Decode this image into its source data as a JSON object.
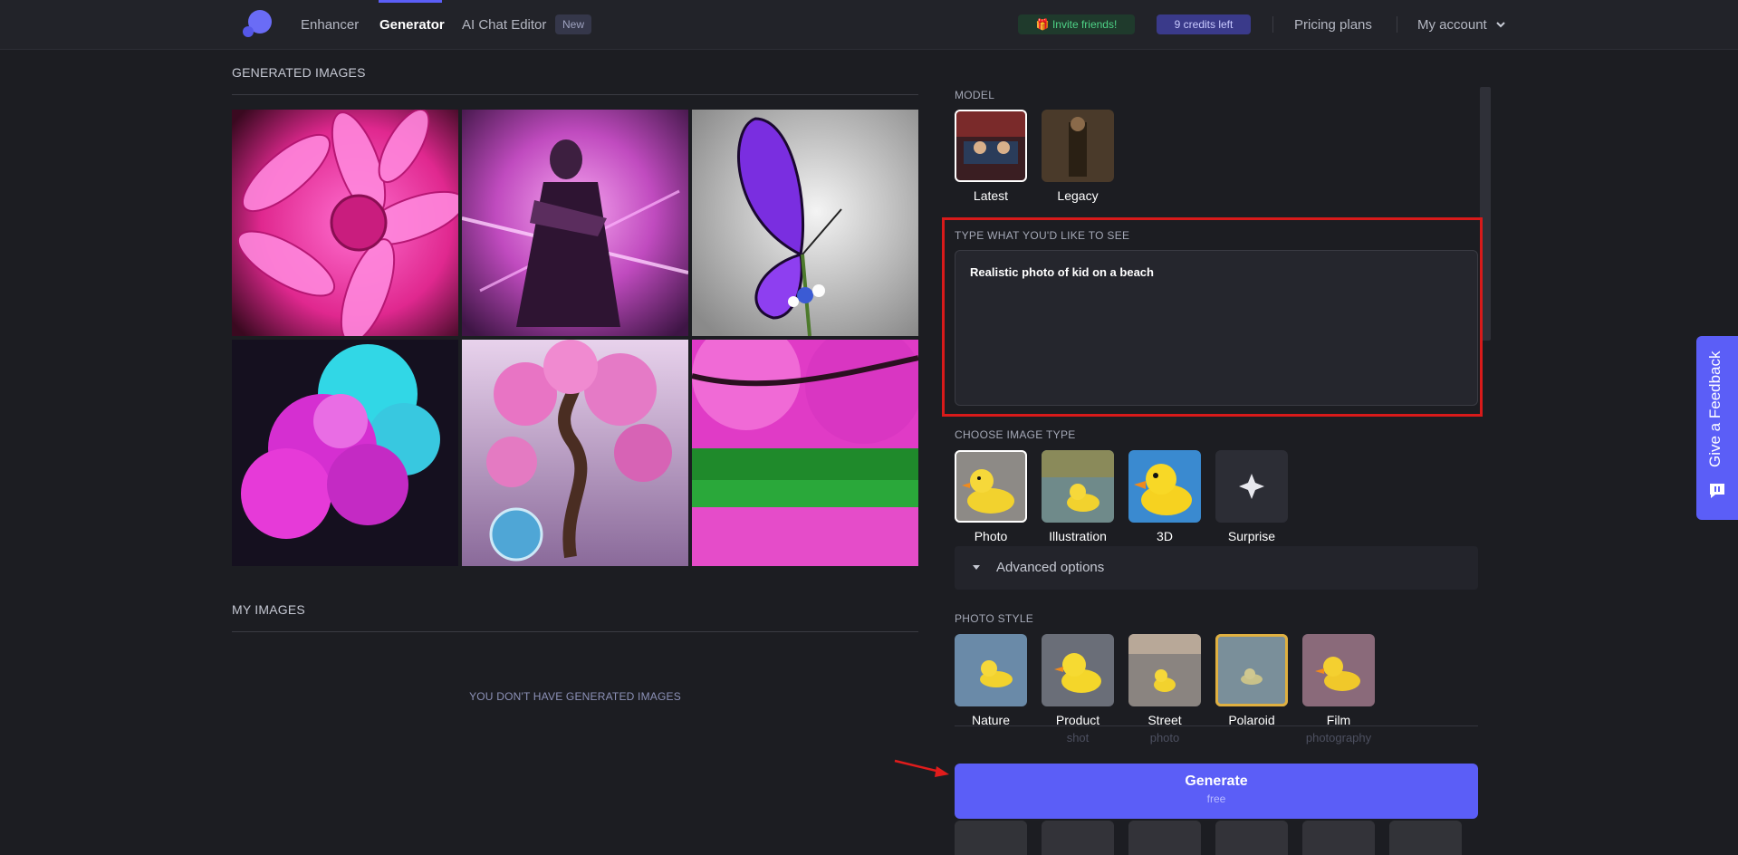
{
  "nav": {
    "items": [
      {
        "label": "Enhancer"
      },
      {
        "label": "Generator"
      },
      {
        "label": "AI Chat Editor"
      }
    ],
    "new_badge": "New",
    "invite": "🎁 Invite friends!",
    "credits": "9 credits left",
    "pricing": "Pricing plans",
    "account": "My account"
  },
  "generated": {
    "title": "GENERATED IMAGES",
    "images": [
      "pink-dahlia-flower",
      "purple-warrior-woman",
      "purple-butterfly",
      "cyan-magenta-smoke",
      "pink-bonsai-tree",
      "pink-trees-lake"
    ]
  },
  "my_images": {
    "title": "MY IMAGES",
    "empty": "YOU DON'T HAVE GENERATED IMAGES"
  },
  "panel": {
    "model_label": "MODEL",
    "models": [
      {
        "label": "Latest",
        "selected": true
      },
      {
        "label": "Legacy",
        "selected": false
      }
    ],
    "prompt_label": "TYPE WHAT YOU'D LIKE TO SEE",
    "prompt_value": "Realistic photo of kid on a beach",
    "image_type_label": "CHOOSE IMAGE TYPE",
    "image_types": [
      {
        "label": "Photo",
        "selected": true
      },
      {
        "label": "Illustration",
        "selected": false
      },
      {
        "label": "3D",
        "selected": false
      },
      {
        "label": "Surprise",
        "selected": false
      }
    ],
    "advanced": "Advanced options",
    "photo_style_label": "PHOTO STYLE",
    "photo_styles": [
      {
        "label": "Nature",
        "sub": ""
      },
      {
        "label": "Product",
        "sub": "shot"
      },
      {
        "label": "Street",
        "sub": "photo"
      },
      {
        "label": "Polaroid",
        "sub": "",
        "selected": true
      },
      {
        "label": "Film",
        "sub": "photography"
      }
    ],
    "generate": {
      "title": "Generate",
      "sub": "free"
    }
  },
  "feedback": "Give a Feedback",
  "colors": {
    "accent": "#5b5ef7",
    "background": "#1c1d22",
    "annotation": "#d81a1a"
  }
}
